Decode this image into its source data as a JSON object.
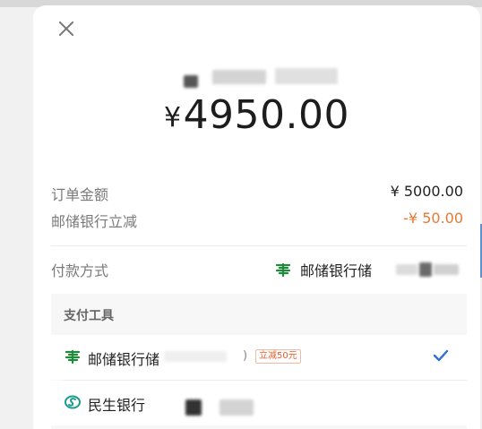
{
  "amount": {
    "symbol": "¥",
    "value": "4950.00"
  },
  "summary": {
    "order_label": "订单金额",
    "order_value": "¥ 5000.00",
    "discount_label": "邮储银行立减",
    "discount_value": "-¥ 50.00"
  },
  "payment": {
    "label": "付款方式",
    "value": "邮储银行储"
  },
  "tools": {
    "heading": "支付工具",
    "items": [
      {
        "name": "邮储银行储",
        "paren": ")",
        "badge": "立减50元",
        "selected": true
      },
      {
        "name": "民生银行",
        "selected": false
      }
    ]
  },
  "colors": {
    "discount": "#e67a34",
    "check": "#2f6fd6",
    "psbc_green": "#1f8a3a",
    "cmbc_teal": "#1a9b8f"
  }
}
